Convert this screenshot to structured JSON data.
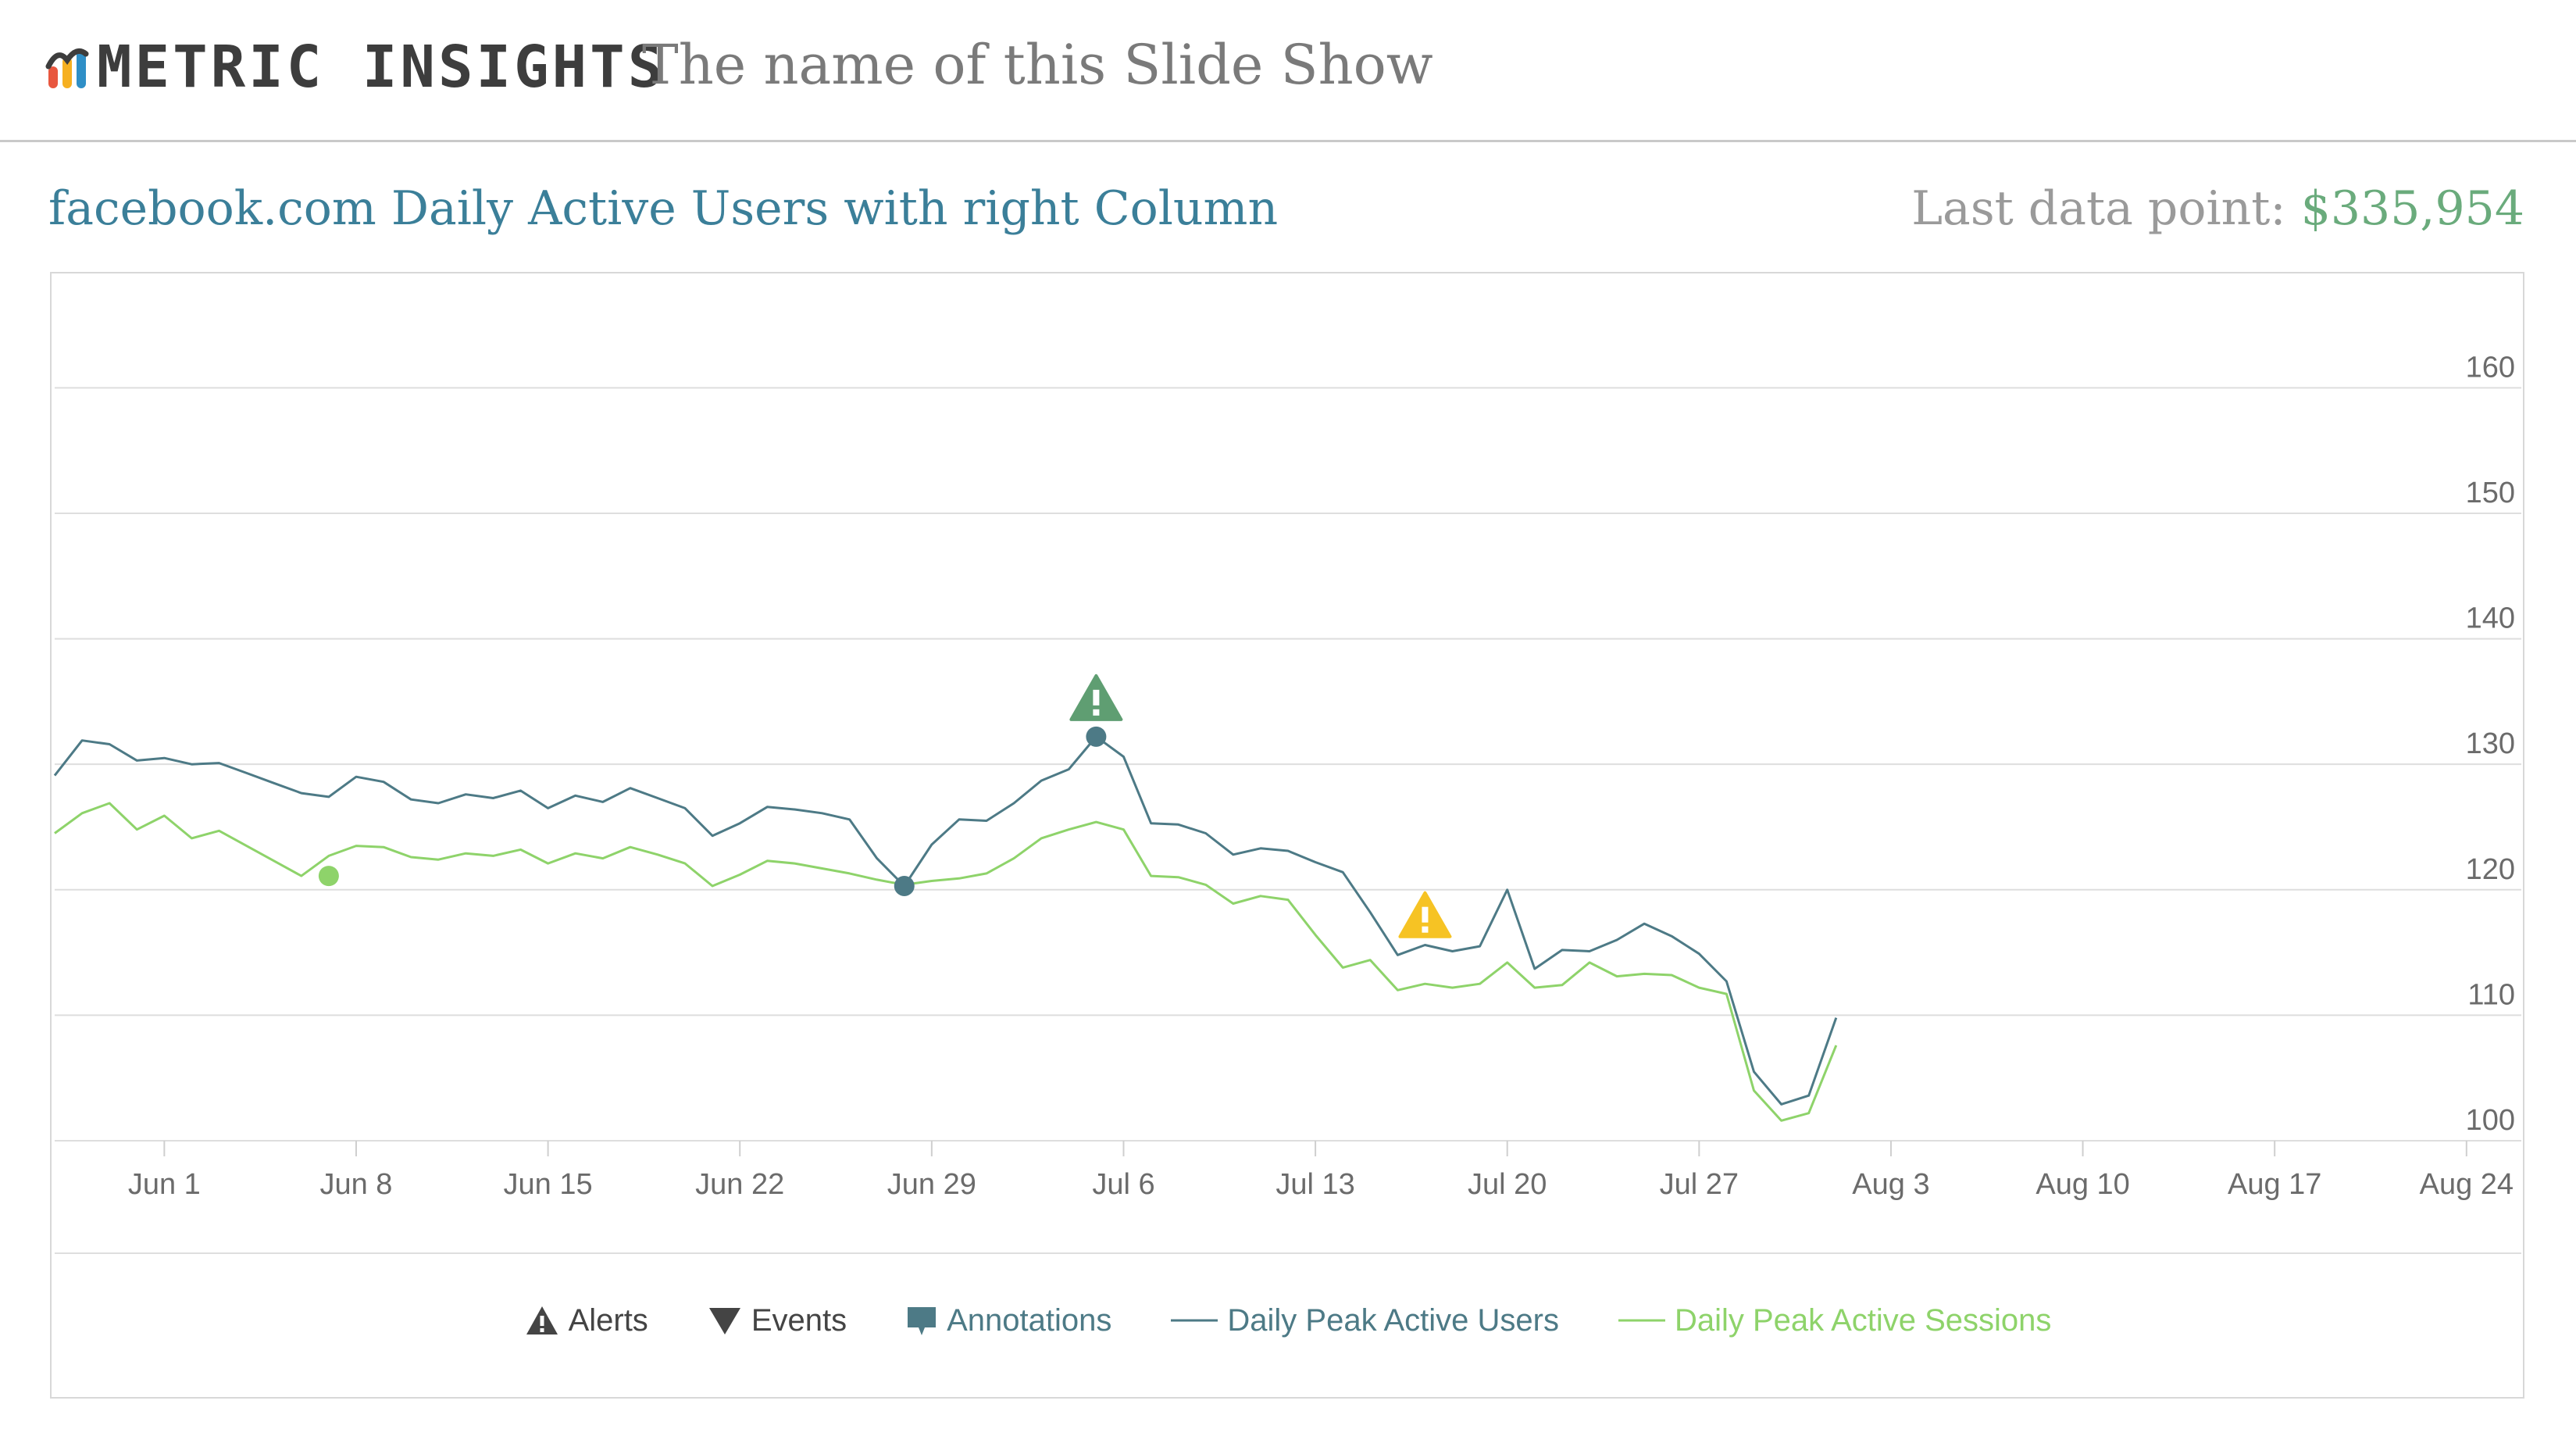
{
  "header": {
    "logo_text": "METRIC INSIGHTS",
    "slideshow_title": "The name of this Slide Show"
  },
  "chart_header": {
    "title": "facebook.com Daily Active Users with right Column",
    "last_point_label": "Last data point:",
    "last_point_value": "$335,954"
  },
  "colors": {
    "users": "#4d7a86",
    "sessions": "#8ed36a",
    "alert_green": "#5f9e72",
    "alert_yellow": "#f6c324",
    "grid": "#dedede",
    "tick_text": "#6b6b6b"
  },
  "legend": [
    {
      "label": "Alerts",
      "icon": "alert-triangle-icon",
      "color": "#444444"
    },
    {
      "label": "Events",
      "icon": "event-triangle-down-icon",
      "color": "#444444"
    },
    {
      "label": "Annotations",
      "icon": "annotation-flag-icon",
      "color": "#4d7a86"
    },
    {
      "label": "Daily Peak Active Users",
      "icon": "line-swatch-icon",
      "color": "#4d7a86"
    },
    {
      "label": "Daily Peak Active Sessions",
      "icon": "line-swatch-icon",
      "color": "#8ed36a"
    }
  ],
  "chart_data": {
    "type": "line",
    "x_start": "2015-05-28",
    "x_end": "2015-08-26",
    "xtick_labels": [
      "Jun 1",
      "Jun 8",
      "Jun 15",
      "Jun 22",
      "Jun 29",
      "Jul 6",
      "Jul 13",
      "Jul 20",
      "Jul 27",
      "Aug 3",
      "Aug 10",
      "Aug 17",
      "Aug 24"
    ],
    "xtick_dates": [
      "2015-06-01",
      "2015-06-08",
      "2015-06-15",
      "2015-06-22",
      "2015-06-29",
      "2015-07-06",
      "2015-07-13",
      "2015-07-20",
      "2015-07-27",
      "2015-08-03",
      "2015-08-10",
      "2015-08-17",
      "2015-08-24"
    ],
    "yticks": [
      100,
      110,
      120,
      130,
      140,
      150,
      160
    ],
    "y_axis_side": "right",
    "ylim": [
      100,
      166
    ],
    "grid": true,
    "legend_position": "bottom",
    "series": [
      {
        "name": "Daily Peak Active Users",
        "points": [
          [
            "2015-05-28",
            129.1
          ],
          [
            "2015-05-29",
            131.9
          ],
          [
            "2015-05-30",
            131.6
          ],
          [
            "2015-05-31",
            130.3
          ],
          [
            "2015-06-01",
            130.5
          ],
          [
            "2015-06-02",
            130.0
          ],
          [
            "2015-06-03",
            130.1
          ],
          [
            "2015-06-04",
            129.3
          ],
          [
            "2015-06-05",
            128.5
          ],
          [
            "2015-06-06",
            127.7
          ],
          [
            "2015-06-07",
            127.4
          ],
          [
            "2015-06-08",
            129.0
          ],
          [
            "2015-06-09",
            128.6
          ],
          [
            "2015-06-10",
            127.2
          ],
          [
            "2015-06-11",
            126.9
          ],
          [
            "2015-06-12",
            127.6
          ],
          [
            "2015-06-13",
            127.3
          ],
          [
            "2015-06-14",
            127.9
          ],
          [
            "2015-06-15",
            126.5
          ],
          [
            "2015-06-16",
            127.5
          ],
          [
            "2015-06-17",
            127.0
          ],
          [
            "2015-06-18",
            128.1
          ],
          [
            "2015-06-19",
            127.3
          ],
          [
            "2015-06-20",
            126.5
          ],
          [
            "2015-06-21",
            124.3
          ],
          [
            "2015-06-22",
            125.3
          ],
          [
            "2015-06-23",
            126.6
          ],
          [
            "2015-06-24",
            126.4
          ],
          [
            "2015-06-25",
            126.1
          ],
          [
            "2015-06-26",
            125.6
          ],
          [
            "2015-06-27",
            122.5
          ],
          [
            "2015-06-28",
            120.3
          ],
          [
            "2015-06-29",
            123.6
          ],
          [
            "2015-06-30",
            125.6
          ],
          [
            "2015-07-01",
            125.5
          ],
          [
            "2015-07-02",
            126.9
          ],
          [
            "2015-07-03",
            128.7
          ],
          [
            "2015-07-04",
            129.6
          ],
          [
            "2015-07-05",
            132.2
          ],
          [
            "2015-07-06",
            130.6
          ],
          [
            "2015-07-07",
            125.3
          ],
          [
            "2015-07-08",
            125.2
          ],
          [
            "2015-07-09",
            124.5
          ],
          [
            "2015-07-10",
            122.8
          ],
          [
            "2015-07-11",
            123.3
          ],
          [
            "2015-07-12",
            123.1
          ],
          [
            "2015-07-13",
            122.2
          ],
          [
            "2015-07-14",
            121.4
          ],
          [
            "2015-07-15",
            118.2
          ],
          [
            "2015-07-16",
            114.8
          ],
          [
            "2015-07-17",
            115.6
          ],
          [
            "2015-07-18",
            115.1
          ],
          [
            "2015-07-19",
            115.5
          ],
          [
            "2015-07-20",
            120.0
          ],
          [
            "2015-07-21",
            113.7
          ],
          [
            "2015-07-22",
            115.2
          ],
          [
            "2015-07-23",
            115.1
          ],
          [
            "2015-07-24",
            116.0
          ],
          [
            "2015-07-25",
            117.3
          ],
          [
            "2015-07-26",
            116.3
          ],
          [
            "2015-07-27",
            114.9
          ],
          [
            "2015-07-28",
            112.7
          ],
          [
            "2015-07-29",
            105.5
          ],
          [
            "2015-07-30",
            102.9
          ],
          [
            "2015-07-31",
            103.6
          ],
          [
            "2015-08-01",
            109.8
          ]
        ]
      },
      {
        "name": "Daily Peak Active Sessions",
        "points": [
          [
            "2015-05-28",
            124.5
          ],
          [
            "2015-05-29",
            126.1
          ],
          [
            "2015-05-30",
            126.9
          ],
          [
            "2015-05-31",
            124.8
          ],
          [
            "2015-06-01",
            125.9
          ],
          [
            "2015-06-02",
            124.1
          ],
          [
            "2015-06-03",
            124.7
          ],
          [
            "2015-06-04",
            123.5
          ],
          [
            "2015-06-05",
            122.3
          ],
          [
            "2015-06-06",
            121.1
          ],
          [
            "2015-06-07",
            122.7
          ],
          [
            "2015-06-08",
            123.5
          ],
          [
            "2015-06-09",
            123.4
          ],
          [
            "2015-06-10",
            122.6
          ],
          [
            "2015-06-11",
            122.4
          ],
          [
            "2015-06-12",
            122.9
          ],
          [
            "2015-06-13",
            122.7
          ],
          [
            "2015-06-14",
            123.2
          ],
          [
            "2015-06-15",
            122.1
          ],
          [
            "2015-06-16",
            122.9
          ],
          [
            "2015-06-17",
            122.5
          ],
          [
            "2015-06-18",
            123.4
          ],
          [
            "2015-06-19",
            122.8
          ],
          [
            "2015-06-20",
            122.1
          ],
          [
            "2015-06-21",
            120.3
          ],
          [
            "2015-06-22",
            121.2
          ],
          [
            "2015-06-23",
            122.3
          ],
          [
            "2015-06-24",
            122.1
          ],
          [
            "2015-06-25",
            121.7
          ],
          [
            "2015-06-26",
            121.3
          ],
          [
            "2015-06-27",
            120.8
          ],
          [
            "2015-06-28",
            120.4
          ],
          [
            "2015-06-29",
            120.7
          ],
          [
            "2015-06-30",
            120.9
          ],
          [
            "2015-07-01",
            121.3
          ],
          [
            "2015-07-02",
            122.5
          ],
          [
            "2015-07-03",
            124.1
          ],
          [
            "2015-07-04",
            124.8
          ],
          [
            "2015-07-05",
            125.4
          ],
          [
            "2015-07-06",
            124.8
          ],
          [
            "2015-07-07",
            121.1
          ],
          [
            "2015-07-08",
            121.0
          ],
          [
            "2015-07-09",
            120.4
          ],
          [
            "2015-07-10",
            118.9
          ],
          [
            "2015-07-11",
            119.5
          ],
          [
            "2015-07-12",
            119.2
          ],
          [
            "2015-07-13",
            116.4
          ],
          [
            "2015-07-14",
            113.8
          ],
          [
            "2015-07-15",
            114.4
          ],
          [
            "2015-07-16",
            112.0
          ],
          [
            "2015-07-17",
            112.5
          ],
          [
            "2015-07-18",
            112.2
          ],
          [
            "2015-07-19",
            112.5
          ],
          [
            "2015-07-20",
            114.2
          ],
          [
            "2015-07-21",
            112.2
          ],
          [
            "2015-07-22",
            112.4
          ],
          [
            "2015-07-23",
            114.2
          ],
          [
            "2015-07-24",
            113.1
          ],
          [
            "2015-07-25",
            113.3
          ],
          [
            "2015-07-26",
            113.2
          ],
          [
            "2015-07-27",
            112.2
          ],
          [
            "2015-07-28",
            111.7
          ],
          [
            "2015-07-29",
            104.0
          ],
          [
            "2015-07-30",
            101.6
          ],
          [
            "2015-07-31",
            102.2
          ],
          [
            "2015-08-01",
            107.6
          ]
        ]
      }
    ],
    "markers": [
      {
        "kind": "dot",
        "series": "Daily Peak Active Sessions",
        "x": "2015-06-07",
        "y": 121.1
      },
      {
        "kind": "dot",
        "series": "Daily Peak Active Users",
        "x": "2015-06-28",
        "y": 120.3
      },
      {
        "kind": "dot",
        "series": "Daily Peak Active Users",
        "x": "2015-07-05",
        "y": 132.2
      },
      {
        "kind": "alert",
        "color": "#5f9e72",
        "x": "2015-07-05",
        "y": 132.2
      },
      {
        "kind": "alert",
        "color": "#f6c324",
        "x": "2015-07-17",
        "y": 114.9
      }
    ]
  }
}
